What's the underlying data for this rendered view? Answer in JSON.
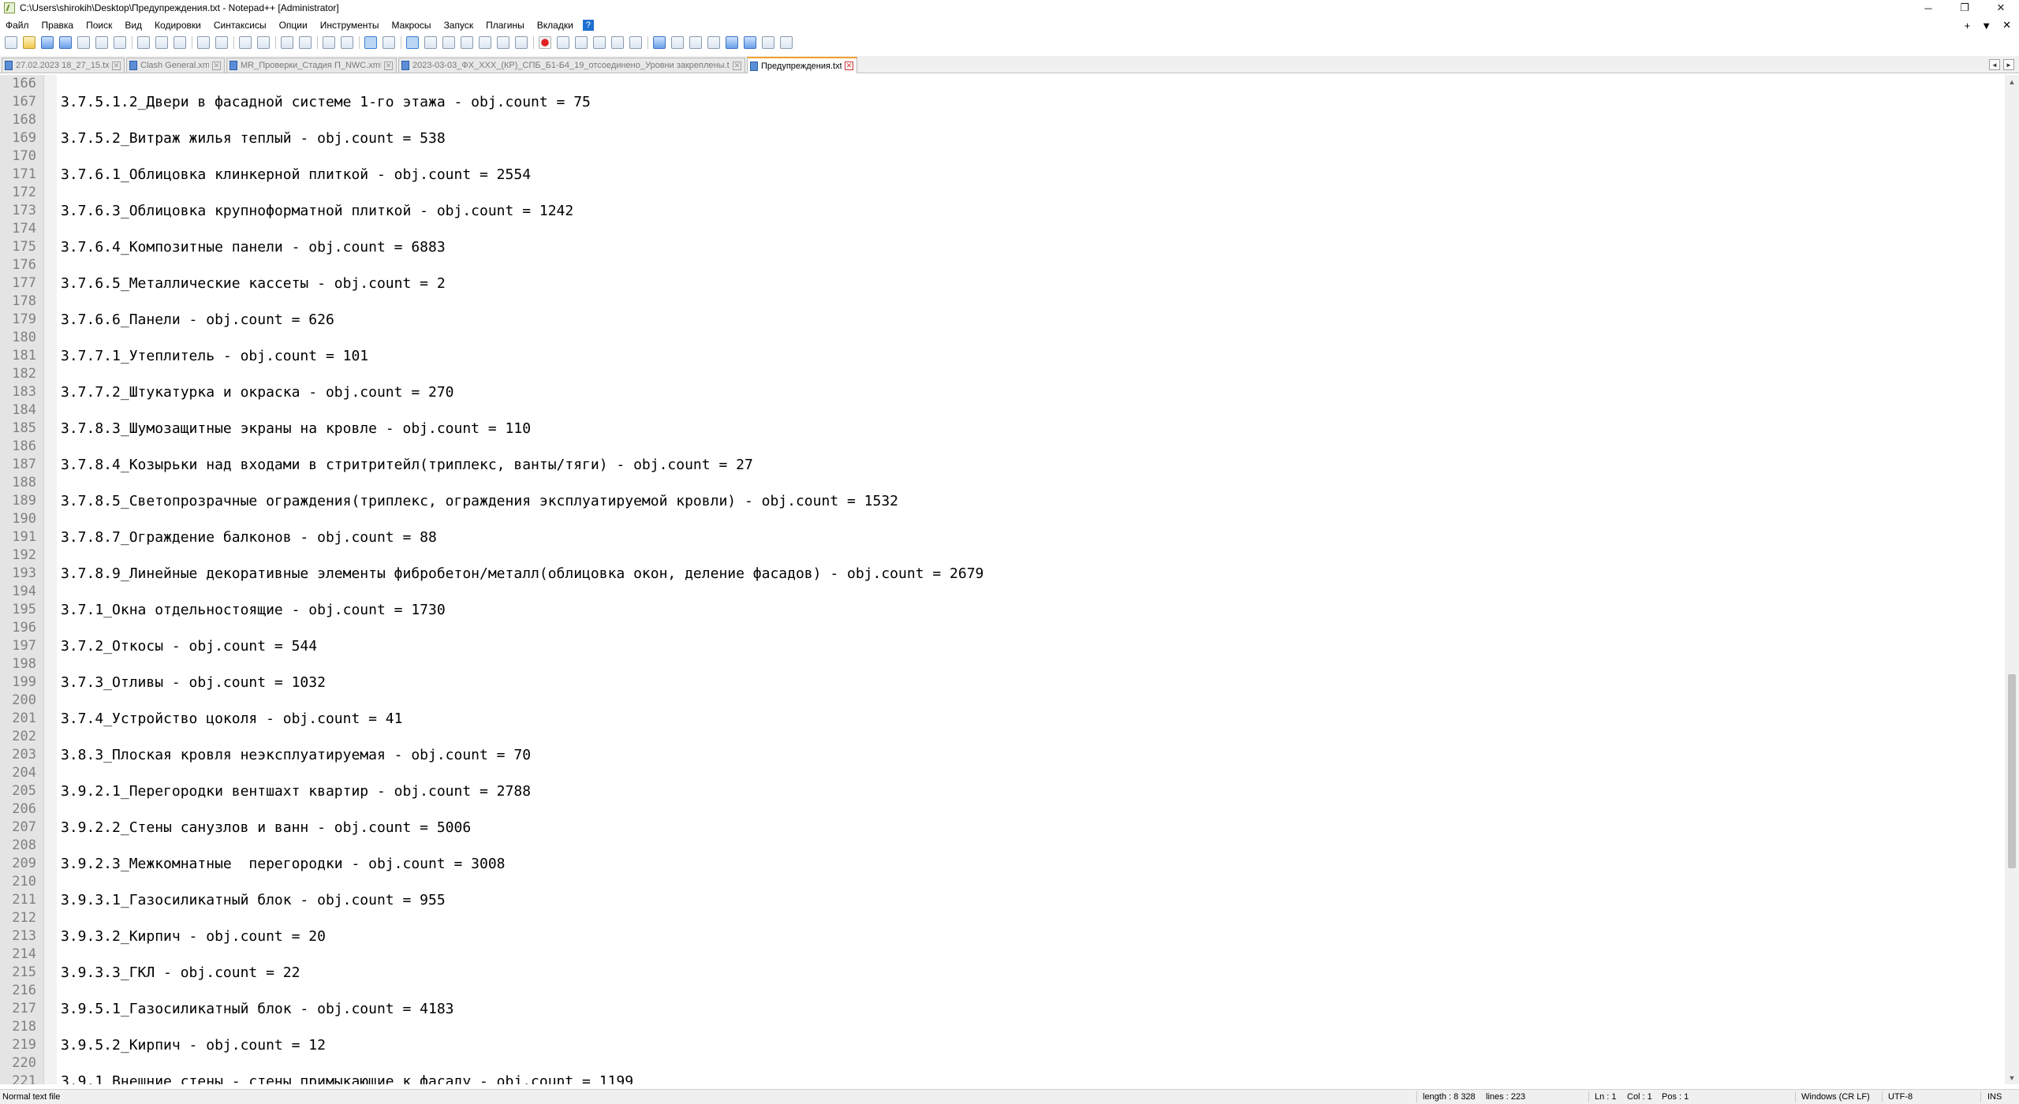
{
  "window": {
    "title": "C:\\Users\\shirokih\\Desktop\\Предупреждения.txt - Notepad++ [Administrator]",
    "controls": {
      "minimize": "─",
      "restore": "❐",
      "close": "✕"
    }
  },
  "menu": {
    "items": [
      "Файл",
      "Правка",
      "Поиск",
      "Вид",
      "Кодировки",
      "Синтаксисы",
      "Опции",
      "Инструменты",
      "Макросы",
      "Запуск",
      "Плагины",
      "Вкладки"
    ],
    "help": "?",
    "right": {
      "add": "+",
      "dropdown": "▼",
      "close": "✕"
    }
  },
  "tabs": [
    {
      "label": "27.02.2023 18_27_15.txt",
      "active": false
    },
    {
      "label": "Clash General.xml",
      "active": false
    },
    {
      "label": "MR_Проверки_Стадия П_NWC.xml",
      "active": false
    },
    {
      "label": "2023-03-03_ФХ_XXX_(КР)_СПБ_Б1-Б4_19_отсоединено_Уровни закреплены.txt",
      "active": false
    },
    {
      "label": "Предупреждения.txt",
      "active": true
    }
  ],
  "tab_nav": {
    "prev": "◄",
    "next": "►"
  },
  "editor": {
    "lines": [
      {
        "n": "166",
        "text": ""
      },
      {
        "n": "167",
        "text": "3.7.5.1.2_Двери в фасадной системе 1-го этажа - obj.count = 75"
      },
      {
        "n": "168",
        "text": ""
      },
      {
        "n": "169",
        "text": "3.7.5.2_Витраж жилья теплый - obj.count = 538"
      },
      {
        "n": "170",
        "text": ""
      },
      {
        "n": "171",
        "text": "3.7.6.1_Облицовка клинкерной плиткой - obj.count = 2554"
      },
      {
        "n": "172",
        "text": ""
      },
      {
        "n": "173",
        "text": "3.7.6.3_Облицовка крупноформатной плиткой - obj.count = 1242"
      },
      {
        "n": "174",
        "text": ""
      },
      {
        "n": "175",
        "text": "3.7.6.4_Композитные панели - obj.count = 6883"
      },
      {
        "n": "176",
        "text": ""
      },
      {
        "n": "177",
        "text": "3.7.6.5_Металлические кассеты - obj.count = 2"
      },
      {
        "n": "178",
        "text": ""
      },
      {
        "n": "179",
        "text": "3.7.6.6_Панели - obj.count = 626"
      },
      {
        "n": "180",
        "text": ""
      },
      {
        "n": "181",
        "text": "3.7.7.1_Утеплитель - obj.count = 101"
      },
      {
        "n": "182",
        "text": ""
      },
      {
        "n": "183",
        "text": "3.7.7.2_Штукатурка и окраска - obj.count = 270"
      },
      {
        "n": "184",
        "text": ""
      },
      {
        "n": "185",
        "text": "3.7.8.3_Шумозащитные экраны на кровле - obj.count = 110"
      },
      {
        "n": "186",
        "text": ""
      },
      {
        "n": "187",
        "text": "3.7.8.4_Козырьки над входами в стритритейл(триплекс, ванты/тяги) - obj.count = 27"
      },
      {
        "n": "188",
        "text": ""
      },
      {
        "n": "189",
        "text": "3.7.8.5_Светопрозрачные ограждения(триплекс, ограждения эксплуатируемой кровли) - obj.count = 1532"
      },
      {
        "n": "190",
        "text": ""
      },
      {
        "n": "191",
        "text": "3.7.8.7_Ограждение балконов - obj.count = 88"
      },
      {
        "n": "192",
        "text": ""
      },
      {
        "n": "193",
        "text": "3.7.8.9_Линейные декоративные элементы фибробетон/металл(облицовка окон, деление фасадов) - obj.count = 2679"
      },
      {
        "n": "194",
        "text": ""
      },
      {
        "n": "195",
        "text": "3.7.1_Окна отдельностоящие - obj.count = 1730"
      },
      {
        "n": "196",
        "text": ""
      },
      {
        "n": "197",
        "text": "3.7.2_Откосы - obj.count = 544"
      },
      {
        "n": "198",
        "text": ""
      },
      {
        "n": "199",
        "text": "3.7.3_Отливы - obj.count = 1032"
      },
      {
        "n": "200",
        "text": ""
      },
      {
        "n": "201",
        "text": "3.7.4_Устройство цоколя - obj.count = 41"
      },
      {
        "n": "202",
        "text": ""
      },
      {
        "n": "203",
        "text": "3.8.3_Плоская кровля неэксплуатируемая - obj.count = 70"
      },
      {
        "n": "204",
        "text": ""
      },
      {
        "n": "205",
        "text": "3.9.2.1_Перегородки вентшахт квартир - obj.count = 2788"
      },
      {
        "n": "206",
        "text": ""
      },
      {
        "n": "207",
        "text": "3.9.2.2_Стены санузлов и ванн - obj.count = 5006"
      },
      {
        "n": "208",
        "text": ""
      },
      {
        "n": "209",
        "text": "3.9.2.3_Межкомнатные  перегородки - obj.count = 3008"
      },
      {
        "n": "210",
        "text": ""
      },
      {
        "n": "211",
        "text": "3.9.3.1_Газосиликатный блок - obj.count = 955"
      },
      {
        "n": "212",
        "text": ""
      },
      {
        "n": "213",
        "text": "3.9.3.2_Кирпич - obj.count = 20"
      },
      {
        "n": "214",
        "text": ""
      },
      {
        "n": "215",
        "text": "3.9.3.3_ГКЛ - obj.count = 22"
      },
      {
        "n": "216",
        "text": ""
      },
      {
        "n": "217",
        "text": "3.9.5.1_Газосиликатный блок - obj.count = 4183"
      },
      {
        "n": "218",
        "text": ""
      },
      {
        "n": "219",
        "text": "3.9.5.2_Кирпич - obj.count = 12"
      },
      {
        "n": "220",
        "text": ""
      },
      {
        "n": "221",
        "text": "3.9.1_Внешние стены - стены примыкающие к фасаду - obj.count = 1199"
      }
    ]
  },
  "scrollbar": {
    "up": "▲",
    "down": "▼"
  },
  "status": {
    "file_type": "Normal text file",
    "length": "length : 8 328",
    "lines": "lines : 223",
    "ln": "Ln : 1",
    "col": "Col : 1",
    "pos": "Pos : 1",
    "eol": "Windows (CR LF)",
    "encoding": "UTF-8",
    "mode": "INS"
  }
}
